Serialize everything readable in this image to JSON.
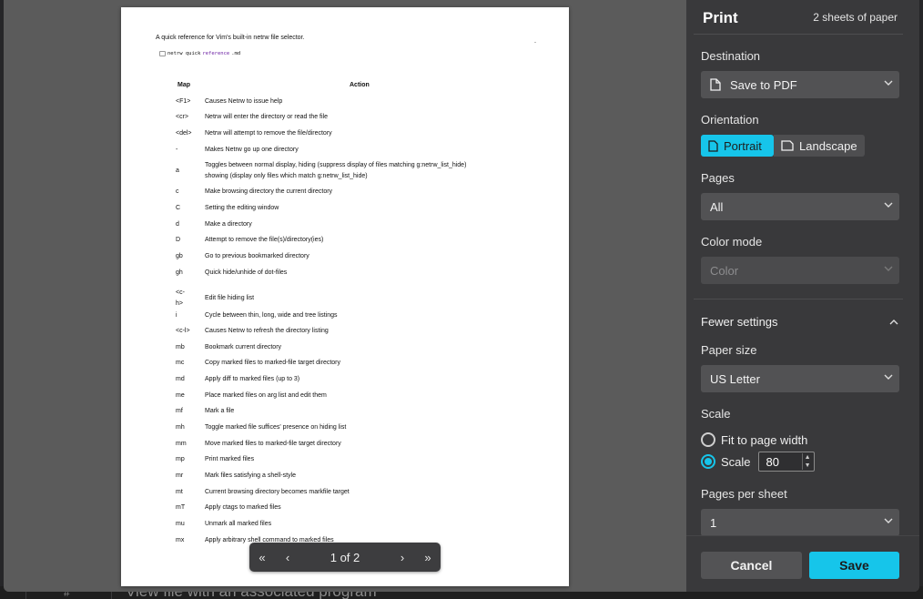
{
  "background": {
    "hash": "#",
    "text": "View file with an associated program"
  },
  "document": {
    "intro": "A quick reference for Vim's built-in netrw file selector.",
    "code": {
      "a": "netrw quick ",
      "b": "reference",
      "c": ".md"
    },
    "headers": {
      "map": "Map",
      "action": "Action"
    },
    "rows": [
      {
        "map": "<F1>",
        "action": "Causes Netrw to issue help"
      },
      {
        "map": "<cr>",
        "action": "Netrw will enter the directory or read the file"
      },
      {
        "map": "<del>",
        "action": "Netrw will attempt to remove the file/directory"
      },
      {
        "map": "-",
        "action": "Makes Netrw go up one directory"
      },
      {
        "map": "a",
        "action": "Toggles between normal display, hiding (suppress display of files matching g:netrw_list_hide)",
        "action2": "showing (display only files which match g:netrw_list_hide)"
      },
      {
        "map": "c",
        "action": "Make browsing directory the current directory"
      },
      {
        "map": "C",
        "action": "Setting the editing window"
      },
      {
        "map": "d",
        "action": "Make a directory"
      },
      {
        "map": "D",
        "action": "Attempt to remove the file(s)/directory(ies)"
      },
      {
        "map": "gb",
        "action": "Go to previous bookmarked directory"
      },
      {
        "map": "gh",
        "action": "Quick hide/unhide of dot-files"
      },
      {
        "map": "<c-",
        "map2": "h>",
        "action": "Edit file hiding list"
      },
      {
        "map": "i",
        "action": "Cycle between thin, long, wide and tree listings"
      },
      {
        "map": "<c-l>",
        "action": "Causes Netrw to refresh the directory listing"
      },
      {
        "map": "mb",
        "action": "Bookmark current directory"
      },
      {
        "map": "mc",
        "action": "Copy marked files to marked-file target directory"
      },
      {
        "map": "md",
        "action": "Apply diff to marked files (up to 3)"
      },
      {
        "map": "me",
        "action": "Place marked files on arg list and edit them"
      },
      {
        "map": "mf",
        "action": "Mark a file"
      },
      {
        "map": "mh",
        "action": "Toggle marked file suffices' presence on hiding list"
      },
      {
        "map": "mm",
        "action": "Move marked files to marked-file target directory"
      },
      {
        "map": "mp",
        "action": "Print marked files"
      },
      {
        "map": "mr",
        "action": "Mark files satisfying a shell-style"
      },
      {
        "map": "mt",
        "action": "Current browsing directory becomes markfile target"
      },
      {
        "map": "mT",
        "action": "Apply ctags to marked files"
      },
      {
        "map": "mu",
        "action": "Unmark all marked files"
      },
      {
        "map": "mx",
        "action": "Apply arbitrary shell command to marked files"
      }
    ]
  },
  "pager": {
    "first": "«",
    "prev": "‹",
    "info": "1 of 2",
    "next": "›",
    "last": "»"
  },
  "settings": {
    "title": "Print",
    "sheets": "2 sheets of paper",
    "destination": {
      "label": "Destination",
      "value": "Save to PDF"
    },
    "orientation": {
      "label": "Orientation",
      "portrait": "Portrait",
      "landscape": "Landscape",
      "selected": "Portrait"
    },
    "pages": {
      "label": "Pages",
      "value": "All"
    },
    "color_mode": {
      "label": "Color mode",
      "value": "Color"
    },
    "fewer_settings": "Fewer settings",
    "paper_size": {
      "label": "Paper size",
      "value": "US Letter"
    },
    "scale": {
      "label": "Scale",
      "fit": "Fit to page width",
      "custom": "Scale",
      "value": "80"
    },
    "pages_per_sheet": {
      "label": "Pages per sheet",
      "value": "1"
    },
    "cancel": "Cancel",
    "save": "Save"
  },
  "colors": {
    "accent": "#16c5ea",
    "panel": "#39393b",
    "preview": "#5b5b5b"
  }
}
